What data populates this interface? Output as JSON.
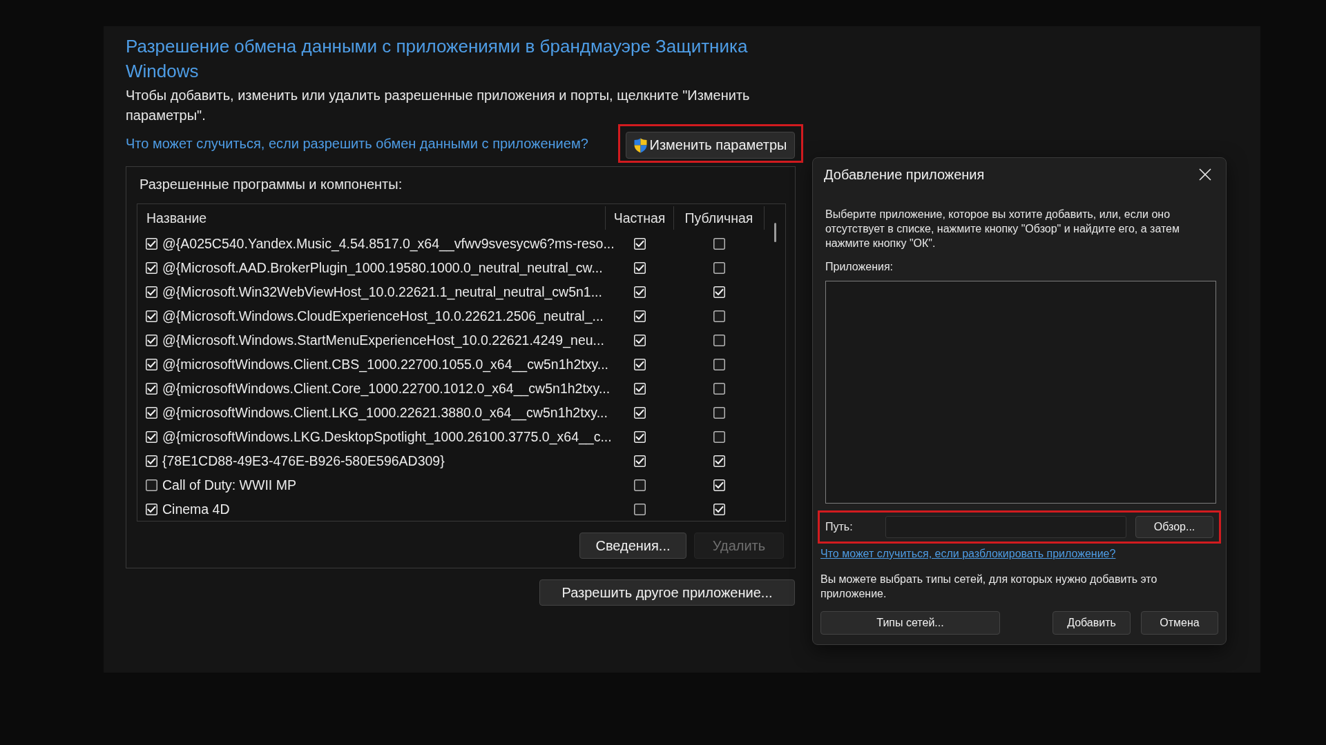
{
  "window": {
    "title": "Разрешение обмена данными с приложениями в брандмауэре Защитника Windows",
    "description": "Чтобы добавить, изменить или удалить разрешенные приложения и порты, щелкните \"Изменить параметры\".",
    "help_link": "Что может случиться, если разрешить обмен данными с приложением?",
    "change_settings_button": {
      "label": "Изменить параметры",
      "highlighted": true
    }
  },
  "allowed_apps": {
    "title": "Разрешенные программы и компоненты:",
    "columns": [
      "Название",
      "Частная",
      "Публичная"
    ],
    "rows": [
      {
        "name": "@{A025C540.Yandex.Music_4.54.8517.0_x64__vfwv9svesycw6?ms-reso...",
        "checked": true,
        "private": true,
        "public": false
      },
      {
        "name": "@{Microsoft.AAD.BrokerPlugin_1000.19580.1000.0_neutral_neutral_cw...",
        "checked": true,
        "private": true,
        "public": false
      },
      {
        "name": "@{Microsoft.Win32WebViewHost_10.0.22621.1_neutral_neutral_cw5n1...",
        "checked": true,
        "private": true,
        "public": true
      },
      {
        "name": "@{Microsoft.Windows.CloudExperienceHost_10.0.22621.2506_neutral_...",
        "checked": true,
        "private": true,
        "public": false
      },
      {
        "name": "@{Microsoft.Windows.StartMenuExperienceHost_10.0.22621.4249_neu...",
        "checked": true,
        "private": true,
        "public": false
      },
      {
        "name": "@{microsoftWindows.Client.CBS_1000.22700.1055.0_x64__cw5n1h2txy...",
        "checked": true,
        "private": true,
        "public": false
      },
      {
        "name": "@{microsoftWindows.Client.Core_1000.22700.1012.0_x64__cw5n1h2txy...",
        "checked": true,
        "private": true,
        "public": false
      },
      {
        "name": "@{microsoftWindows.Client.LKG_1000.22621.3880.0_x64__cw5n1h2txy...",
        "checked": true,
        "private": true,
        "public": false
      },
      {
        "name": "@{microsoftWindows.LKG.DesktopSpotlight_1000.26100.3775.0_x64__c...",
        "checked": true,
        "private": true,
        "public": false
      },
      {
        "name": "{78E1CD88-49E3-476E-B926-580E596AD309}",
        "checked": true,
        "private": true,
        "public": true
      },
      {
        "name": "Call of Duty: WWII MP",
        "checked": false,
        "private": false,
        "public": true
      },
      {
        "name": "Cinema 4D",
        "checked": true,
        "private": false,
        "public": true
      }
    ],
    "buttons": [
      {
        "label": "Сведения...",
        "disabled": false
      },
      {
        "label": "Удалить",
        "disabled": true
      }
    ]
  },
  "allow_another_button": "Разрешить другое приложение...",
  "add_app_dialog": {
    "title": "Добавление приложения",
    "instructions": "Выберите приложение, которое вы хотите добавить, или, если оно отсутствует в списке, нажмите кнопку \"Обзор\" и найдите его, а затем нажмите кнопку \"ОК\".",
    "apps_label": "Приложения:",
    "path_field": {
      "label": "Путь:",
      "highlighted": true
    },
    "browse_button": "Обзор...",
    "help_link": "Что может случиться, если разблокировать приложение?",
    "network_note": "Вы можете выбрать типы сетей, для которых нужно добавить это приложение.",
    "network_types_button": "Типы сетей...",
    "buttons": [
      "Добавить",
      "Отмена"
    ]
  }
}
